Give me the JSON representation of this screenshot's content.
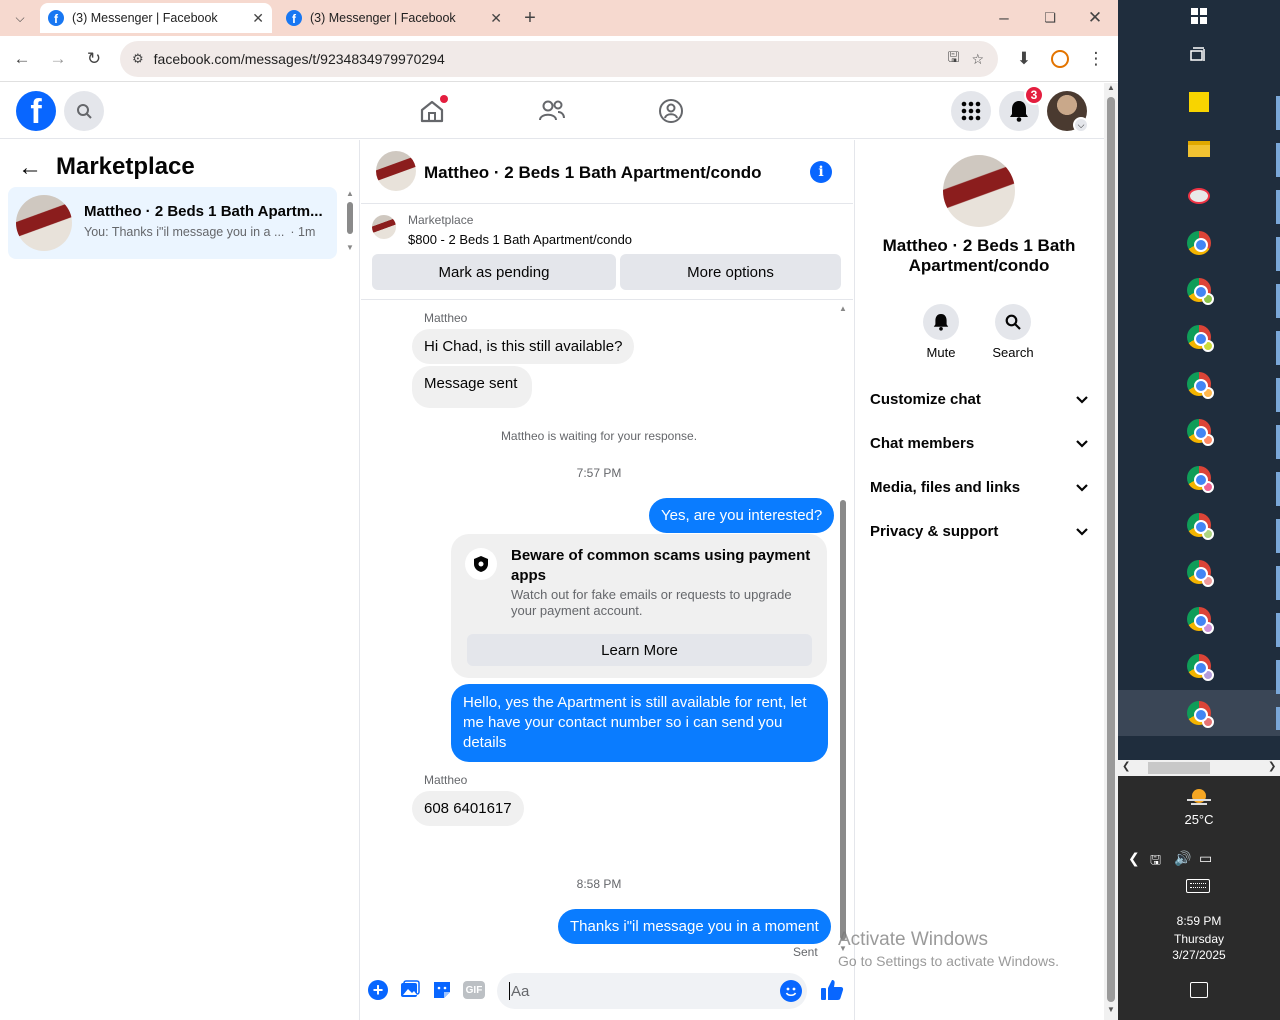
{
  "browser": {
    "tabs": [
      {
        "title": "(3) Messenger | Facebook",
        "active": true
      },
      {
        "title": "(3) Messenger | Facebook",
        "active": false
      }
    ],
    "url": "facebook.com/messages/t/9234834979970294"
  },
  "fb": {
    "notification_count": "3"
  },
  "sidebar": {
    "title": "Marketplace",
    "conversation": {
      "name": "Mattheo · 2 Beds 1 Bath Apartm...",
      "preview": "You: Thanks i\"il message you in a ...",
      "time": "· 1m"
    }
  },
  "chat": {
    "title": "Mattheo · 2 Beds 1 Bath Apartment/condo",
    "listing": {
      "category": "Marketplace",
      "detail": "$800 - 2 Beds 1 Bath Apartment/condo"
    },
    "buttons": {
      "mark_pending": "Mark as pending",
      "more_options": "More options"
    },
    "messages": {
      "sender1": "Mattheo",
      "msg1": "Hi Chad, is this still available?",
      "msg2": "Message sent",
      "waiting": "Mattheo is waiting for your response.",
      "time1": "7:57 PM",
      "out1": "Yes, are you interested?",
      "scam_title": "Beware of common scams using payment apps",
      "scam_body": "Watch out for fake emails or requests to upgrade your payment account.",
      "learn_more": "Learn More",
      "out2": "Hello, yes the Apartment is still available for rent, let me have your contact number so i can send you details",
      "sender2": "Mattheo",
      "msg3": "608 6401617",
      "time2": "8:58 PM",
      "out3": "Thanks i\"il message you in a moment",
      "status": "Sent"
    },
    "composer_placeholder": "Aa"
  },
  "info": {
    "name": "Mattheo · 2 Beds 1 Bath Apartment/condo",
    "mute": "Mute",
    "search": "Search",
    "sections": [
      "Customize chat",
      "Chat members",
      "Media, files and links",
      "Privacy & support"
    ]
  },
  "watermark": {
    "line1": "Activate Windows",
    "line2": "Go to Settings to activate Windows."
  },
  "taskbar": {
    "temp": "25°C",
    "time": "8:59 PM",
    "day": "Thursday",
    "date": "3/27/2025"
  },
  "colors": {
    "fb_blue": "#0866ff",
    "bubble_out": "#0a7cff",
    "badge_red": "#e41e3f",
    "tabbar": "#f6d9cf"
  }
}
